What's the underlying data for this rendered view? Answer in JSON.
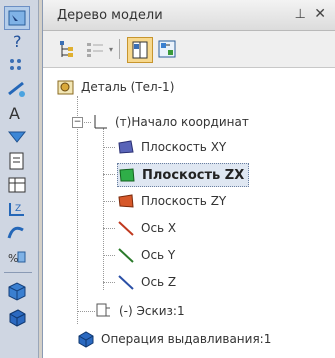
{
  "panel": {
    "title": "Дерево модели",
    "pin_glyph": "⊥",
    "close_glyph": "✕"
  },
  "leftbar": {
    "icons": [
      "select-icon",
      "help-icon",
      "dots-icon",
      "measure-icon",
      "text-icon",
      "arrow-icon",
      "sheet-icon",
      "table-icon",
      "dimension-icon",
      "curve-icon",
      "params-icon",
      "solid-icon",
      "cube-icon"
    ]
  },
  "toolbar": {
    "icons": [
      "tree-view-icon",
      "tree-list-icon",
      "split-view-icon",
      "structure-view-icon"
    ]
  },
  "tree": {
    "root": "Деталь (Тел-1)",
    "origin": "(т)Начало координат",
    "items": [
      {
        "label": "Плоскость XY",
        "icon": "plane-xy-icon",
        "color": "#4a57a8"
      },
      {
        "label": "Плоскость ZX",
        "icon": "plane-zx-icon",
        "color": "#1f9a3a"
      },
      {
        "label": "Плоскость ZY",
        "icon": "plane-zy-icon",
        "color": "#c84a1e"
      },
      {
        "label": "Ось X",
        "icon": "axis-x-icon",
        "color": "#c0391f"
      },
      {
        "label": "Ось Y",
        "icon": "axis-y-icon",
        "color": "#2b7a2b"
      },
      {
        "label": "Ось Z",
        "icon": "axis-z-icon",
        "color": "#2a4fa6"
      }
    ],
    "sketch": "(-) Эскиз:1",
    "operation": "Операция выдавливания:1"
  }
}
